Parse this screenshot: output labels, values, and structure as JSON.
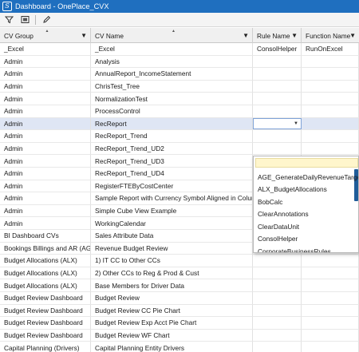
{
  "window": {
    "title": "Dashboard - OnePlace_CVX",
    "app_icon_glyph": "S"
  },
  "toolbar": {
    "icons": [
      "filter-icon",
      "grid-settings-icon",
      "edit-pencil-icon"
    ]
  },
  "columns": [
    {
      "label": "CV Group"
    },
    {
      "label": "CV Name"
    },
    {
      "label": "Rule Name"
    },
    {
      "label": "Function Name"
    }
  ],
  "rows": [
    {
      "group": "_Excel",
      "name": "_Excel",
      "rule": "ConsolHelper",
      "func": "RunOnExcel"
    },
    {
      "group": "Admin",
      "name": "Analysis",
      "rule": "",
      "func": ""
    },
    {
      "group": "Admin",
      "name": "AnnualReport_IncomeStatement",
      "rule": "",
      "func": ""
    },
    {
      "group": "Admin",
      "name": "ChrisTest_Tree",
      "rule": "",
      "func": ""
    },
    {
      "group": "Admin",
      "name": "NormalizationTest",
      "rule": "",
      "func": ""
    },
    {
      "group": "Admin",
      "name": "ProcessControl",
      "rule": "",
      "func": ""
    },
    {
      "group": "Admin",
      "name": "RecReport",
      "rule": "",
      "func": ""
    },
    {
      "group": "Admin",
      "name": "RecReport_Trend",
      "rule": "",
      "func": ""
    },
    {
      "group": "Admin",
      "name": "RecReport_Trend_UD2",
      "rule": "",
      "func": ""
    },
    {
      "group": "Admin",
      "name": "RecReport_Trend_UD3",
      "rule": "",
      "func": ""
    },
    {
      "group": "Admin",
      "name": "RecReport_Trend_UD4",
      "rule": "",
      "func": ""
    },
    {
      "group": "Admin",
      "name": "RegisterFTEByCostCenter",
      "rule": "",
      "func": ""
    },
    {
      "group": "Admin",
      "name": "Sample Report with Currency Symbol Aligned in Column",
      "rule": "",
      "func": ""
    },
    {
      "group": "Admin",
      "name": "Simple Cube View Example",
      "rule": "",
      "func": ""
    },
    {
      "group": "Admin",
      "name": "WorkingCalendar",
      "rule": "",
      "func": ""
    },
    {
      "group": "BI Dashboard CVs",
      "name": "Sales Attribute Data",
      "rule": "",
      "func": ""
    },
    {
      "group": "Bookings Billings and AR (AGE)",
      "name": "Revenue Budget Review",
      "rule": "",
      "func": ""
    },
    {
      "group": "Budget Allocations (ALX)",
      "name": "1) IT CC to Other CCs",
      "rule": "",
      "func": ""
    },
    {
      "group": "Budget Allocations (ALX)",
      "name": "2) Other CCs to Reg & Prod & Cust",
      "rule": "",
      "func": ""
    },
    {
      "group": "Budget Allocations (ALX)",
      "name": "Base Members for Driver Data",
      "rule": "",
      "func": ""
    },
    {
      "group": "Budget Review Dashboard",
      "name": "Budget Review",
      "rule": "",
      "func": ""
    },
    {
      "group": "Budget Review Dashboard",
      "name": "Budget Review CC Pie Chart",
      "rule": "",
      "func": ""
    },
    {
      "group": "Budget Review Dashboard",
      "name": "Budget Review Exp Acct Pie Chart",
      "rule": "",
      "func": ""
    },
    {
      "group": "Budget Review Dashboard",
      "name": "Budget Review WF Chart",
      "rule": "",
      "func": ""
    },
    {
      "group": "Capital Planning (Drivers)",
      "name": "Capital Planning Entity Drivers",
      "rule": "",
      "func": ""
    }
  ],
  "selected_row_index": 6,
  "dropdown": {
    "options": [
      "AGE_GenerateDailyRevenueTargets",
      "ALX_BudgetAllocations",
      "BobCalc",
      "ClearAnnotations",
      "ClearDataUnit",
      "ConsolHelper",
      "CorporateBusinessRules"
    ]
  },
  "colors": {
    "titlebar": "#1f6fbf",
    "selected_row": "#dfe6f4",
    "dropdown_input": "#fff6cc",
    "scrollbar": "#1f5c99"
  }
}
